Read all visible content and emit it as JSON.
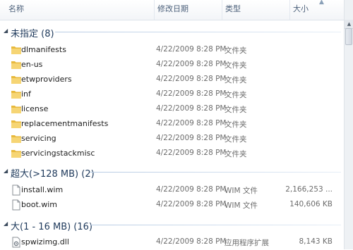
{
  "columns": {
    "name": "名称",
    "date": "修改日期",
    "type": "类型",
    "size": "大小"
  },
  "groups": [
    {
      "title": "未指定 (8)",
      "items": [
        {
          "name": "dlmanifests",
          "date": "4/22/2009 8:28 PM",
          "type": "文件夹",
          "size": "",
          "icon": "folder-icon"
        },
        {
          "name": "en-us",
          "date": "4/22/2009 8:28 PM",
          "type": "文件夹",
          "size": "",
          "icon": "folder-icon"
        },
        {
          "name": "etwproviders",
          "date": "4/22/2009 8:28 PM",
          "type": "文件夹",
          "size": "",
          "icon": "folder-icon"
        },
        {
          "name": "inf",
          "date": "4/22/2009 8:28 PM",
          "type": "文件夹",
          "size": "",
          "icon": "folder-icon"
        },
        {
          "name": "license",
          "date": "4/22/2009 8:28 PM",
          "type": "文件夹",
          "size": "",
          "icon": "folder-icon"
        },
        {
          "name": "replacementmanifests",
          "date": "4/22/2009 8:28 PM",
          "type": "文件夹",
          "size": "",
          "icon": "folder-icon"
        },
        {
          "name": "servicing",
          "date": "4/22/2009 8:28 PM",
          "type": "文件夹",
          "size": "",
          "icon": "folder-icon"
        },
        {
          "name": "servicingstackmisc",
          "date": "4/22/2009 8:28 PM",
          "type": "文件夹",
          "size": "",
          "icon": "folder-icon"
        }
      ]
    },
    {
      "title": "超大(>128 MB) (2)",
      "items": [
        {
          "name": "install.wim",
          "date": "4/22/2009 8:28 PM",
          "type": "WIM 文件",
          "size": "2,166,253 ...",
          "icon": "file-icon"
        },
        {
          "name": "boot.wim",
          "date": "4/22/2009 8:28 PM",
          "type": "WIM 文件",
          "size": "140,606 KB",
          "icon": "file-icon"
        }
      ]
    },
    {
      "title": "大(1 - 16 MB) (16)",
      "items": [
        {
          "name": "spwizimg.dll",
          "date": "4/22/2009 8:28 PM",
          "type": "应用程序扩展",
          "size": "8,143 KB",
          "icon": "dll-file-icon"
        }
      ]
    }
  ]
}
